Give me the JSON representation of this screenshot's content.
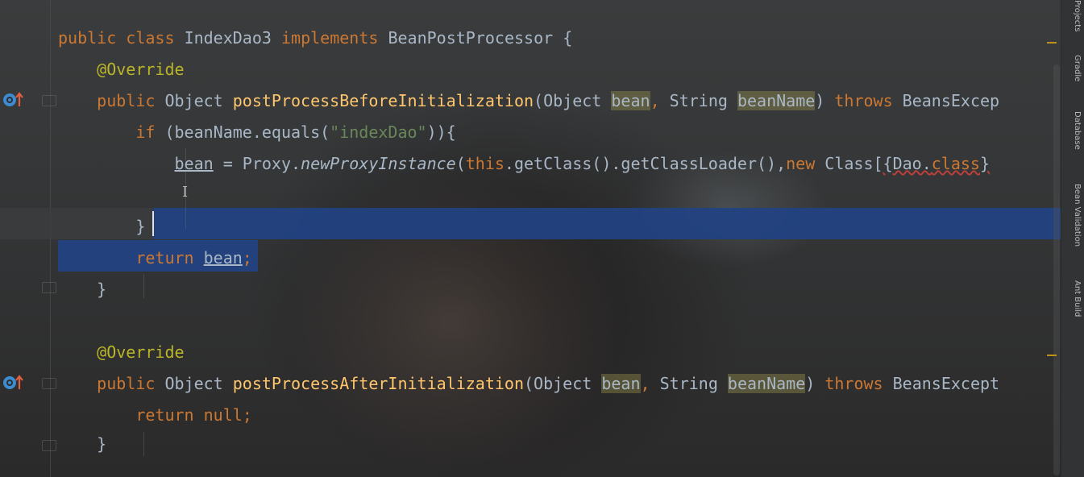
{
  "code": {
    "l1": {
      "kw1": "public",
      "kw2": "class",
      "name": "IndexDao3",
      "kw3": "implements",
      "iface": "BeanPostProcessor",
      "brace": "{"
    },
    "l2": {
      "ann": "@Override"
    },
    "l3": {
      "kw": "public",
      "type": "Object",
      "fn": "postProcessBeforeInitialization",
      "p1type": "(Object",
      "p1": "bean",
      "comma": ",",
      "p2type": "String",
      "p2": "beanName",
      "close": ")",
      "throws": "throws",
      "exc": "BeansExcep"
    },
    "l4": {
      "kw": "if",
      "pre": "(beanName.equals(",
      "str": "\"indexDao\"",
      "post": ")){"
    },
    "l5": {
      "var": "bean",
      "eq": "= Proxy.",
      "call": "newProxyInstance",
      "args1": "(",
      "this": "this",
      "args2": ".getClass().getClassLoader(),",
      "new": "new",
      "args3": "Class[",
      "arr": "{Dao.",
      "cls": "class",
      "end": "}"
    },
    "l7": {
      "brace": "}"
    },
    "l8": {
      "kw": "return",
      "var": "bean",
      "semi": ";"
    },
    "l9": {
      "brace": "}"
    },
    "l11": {
      "ann": "@Override"
    },
    "l12": {
      "kw": "public",
      "type": "Object",
      "fn": "postProcessAfterInitialization",
      "p1type": "(Object",
      "p1": "bean",
      "comma": ",",
      "p2type": "String",
      "p2": "beanName",
      "close": ")",
      "throws": "throws",
      "exc": "BeansExcept"
    },
    "l13": {
      "kw": "return",
      "val": "null",
      "semi": ";"
    },
    "l14": {
      "brace": "}"
    }
  },
  "side_tabs": {
    "projects": "Projects",
    "gradle": "Gradle",
    "database": "Database",
    "bean_validation": "Bean Validation",
    "ant_build": "Ant Build"
  },
  "icons": {
    "override": "override-gutter-icon",
    "ibeam": "text-cursor-icon"
  }
}
